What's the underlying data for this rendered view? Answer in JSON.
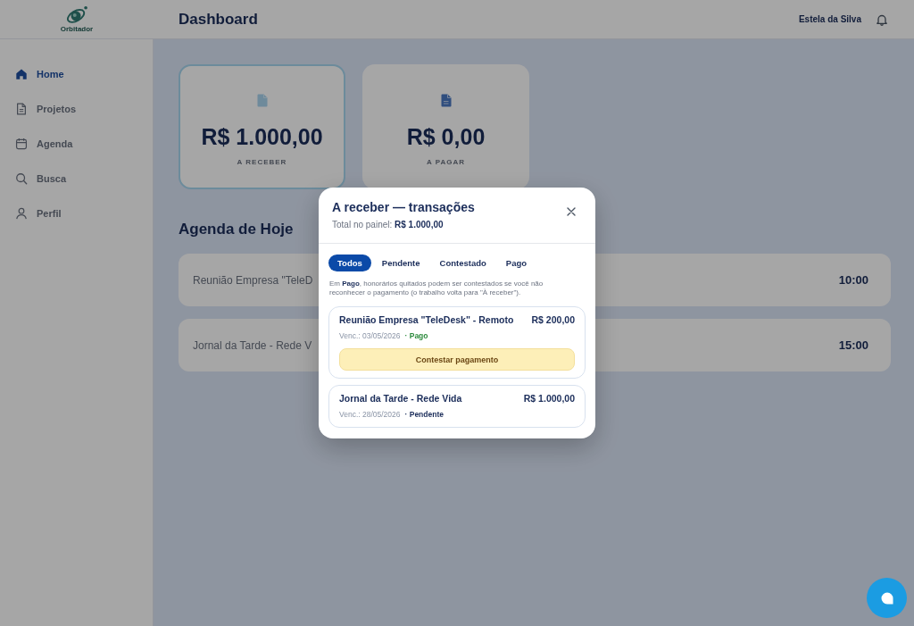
{
  "brand": {
    "name": "Orbitador"
  },
  "header": {
    "title": "Dashboard",
    "user_name": "Estela da Silva"
  },
  "sidebar": {
    "items": [
      {
        "kind": "home",
        "label": "Home",
        "selected": true
      },
      {
        "kind": "document",
        "label": "Projetos",
        "selected": false
      },
      {
        "kind": "calendar",
        "label": "Agenda",
        "selected": false
      },
      {
        "kind": "search",
        "label": "Busca",
        "selected": false
      },
      {
        "kind": "person",
        "label": "Perfil",
        "selected": false
      }
    ]
  },
  "summary_cards": [
    {
      "kind": "receivable",
      "amount": "R$ 1.000,00",
      "label": "A RECEBER",
      "selected": true
    },
    {
      "kind": "payable",
      "amount": "R$ 0,00",
      "label": "A PAGAR",
      "selected": false
    }
  ],
  "agenda": {
    "title": "Agenda de Hoje",
    "rows": [
      {
        "title": "Reunião Empresa \"TeleD",
        "time": "10:00"
      },
      {
        "title": "Jornal da Tarde - Rede V",
        "time": "15:00"
      }
    ]
  },
  "modal": {
    "title": "A receber — transações",
    "subtitle": "Total no painel: **R$ 1.000,00**",
    "tabs": [
      {
        "label": "Todos",
        "selected": true
      },
      {
        "label": "Pendente",
        "selected": false
      },
      {
        "label": "Contestado",
        "selected": false
      },
      {
        "label": "Pago",
        "selected": false
      }
    ],
    "note": "Em **Pago**, honorários quitados podem ser contestados se você não reconhecer o pagamento (o trabalho volta para \"À receber\").",
    "transactions": [
      {
        "title": "Reunião Empresa \"TeleDesk\" - Remoto",
        "amount": "R$ 200,00",
        "due": "Venc.: 03/05/2026",
        "status": "· Pago",
        "color": "#2e8b3e",
        "action": "Contestar pagamento"
      },
      {
        "title": "Jornal da Tarde - Rede Vida",
        "amount": "R$ 1.000,00",
        "due": "Venc.: 28/05/2026",
        "status": "· Pendente",
        "color": "#1b2d5a"
      }
    ]
  }
}
